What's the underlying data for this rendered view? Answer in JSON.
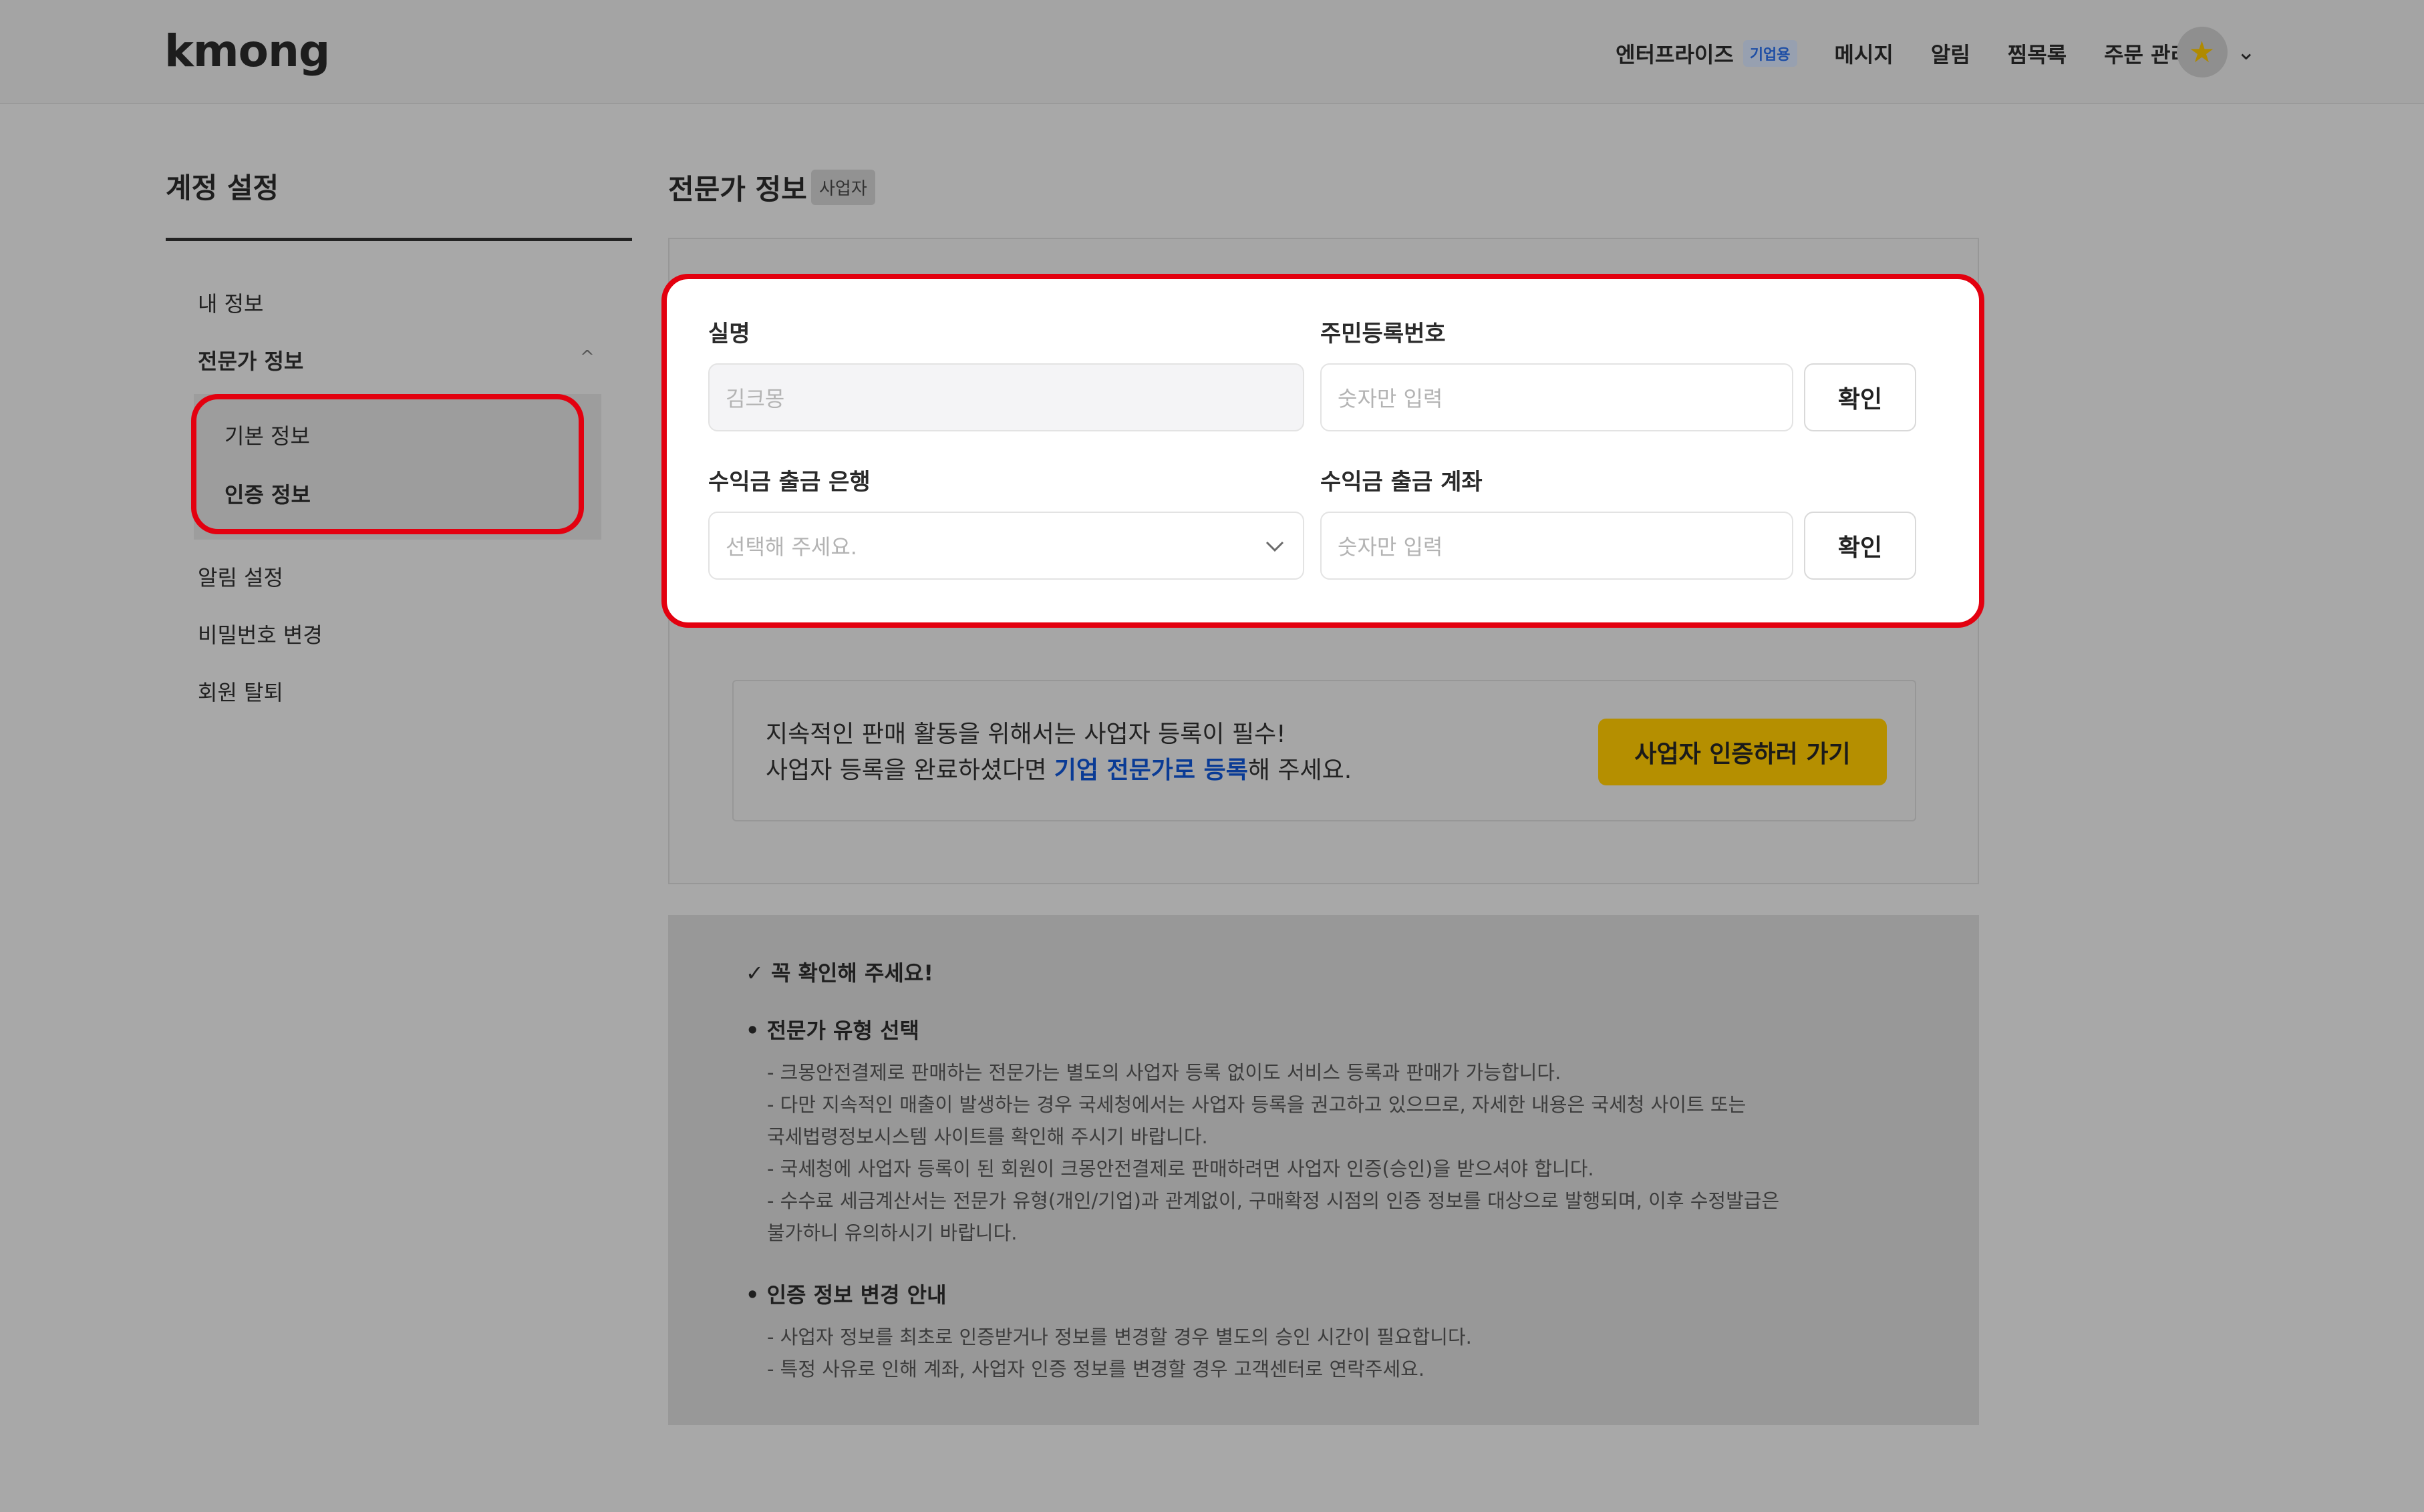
{
  "header": {
    "logo": "kmong",
    "nav": [
      {
        "label": "엔터프라이즈",
        "badge": "기업용"
      },
      {
        "label": "메시지"
      },
      {
        "label": "알림"
      },
      {
        "label": "찜목록"
      },
      {
        "label": "주문 관리"
      }
    ],
    "avatar_icon": "★",
    "menu_icon": "⌄"
  },
  "sidebar": {
    "title": "계정 설정",
    "items": [
      "내 정보",
      "전문가 정보",
      "알림 설정",
      "비밀번호 변경",
      "회원 탈퇴"
    ],
    "sub_items": [
      "기본 정보",
      "인증 정보"
    ],
    "collapse_icon": "^"
  },
  "main": {
    "title": "전문가 정보",
    "badge": "사업자",
    "form": {
      "name_label": "실명",
      "name_value": "김크몽",
      "rrn_label": "주민등록번호",
      "rrn_placeholder": "숫자만 입력",
      "confirm_label": "확인",
      "bank_label": "수익금 출금 은행",
      "bank_placeholder": "선택해 주세요.",
      "account_label": "수익금 출금 계좌",
      "account_placeholder": "숫자만 입력"
    },
    "notice": {
      "line1": "지속적인 판매 활동을 위해서는 사업자 등록이 필수!",
      "line2_pre": "사업자 등록을 완료하셨다면 ",
      "line2_link": "기업 전문가로 등록",
      "line2_post": "해 주세요.",
      "button": "사업자 인증하러 가기"
    },
    "info": {
      "title": "✓  꼭 확인해 주세요!",
      "section1_head": "• 전문가 유형 선택",
      "section1_lines": [
        "- 크몽안전결제로 판매하는 전문가는 별도의 사업자 등록 없이도 서비스 등록과 판매가 가능합니다.",
        "- 다만 지속적인 매출이 발생하는 경우 국세청에서는 사업자 등록을 권고하고 있으므로, 자세한 내용은 국세청 사이트 또는",
        "국세법령정보시스템 사이트를 확인해 주시기 바랍니다.",
        "- 국세청에 사업자 등록이 된 회원이 크몽안전결제로 판매하려면 사업자 인증(승인)을 받으셔야 합니다.",
        "- 수수료 세금계산서는 전문가 유형(개인/기업)과 관계없이, 구매확정 시점의 인증 정보를 대상으로 발행되며, 이후 수정발급은",
        "불가하니 유의하시기 바랍니다."
      ],
      "section2_head": "• 인증 정보 변경 안내",
      "section2_lines": [
        "- 사업자 정보를 최초로 인증받거나 정보를 변경할 경우 별도의 승인 시간이 필요합니다.",
        "- 특정 사유로 인해 계좌, 사업자 인증 정보를 변경할 경우 고객센터로 연락주세요."
      ]
    }
  },
  "colors": {
    "highlight": "#e3000f",
    "cta": "#b58f00",
    "link": "#0a3b95"
  }
}
